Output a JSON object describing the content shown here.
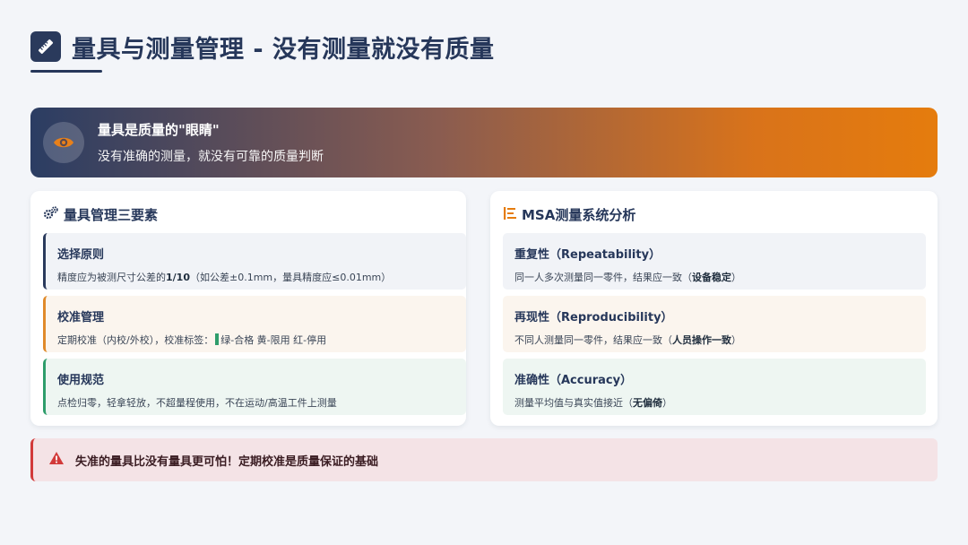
{
  "header": {
    "title": "量具与测量管理 - 没有测量就没有质量",
    "icon": "ruler-icon"
  },
  "banner": {
    "icon": "eye-icon",
    "title": "量具是质量的\"眼睛\"",
    "subtitle": "没有准确的测量，就没有可靠的质量判断"
  },
  "left_panel": {
    "icon": "gears-icon",
    "title": "量具管理三要素",
    "cards": [
      {
        "title": "选择原则",
        "body_pre": "精度应为被测尺寸公差的",
        "body_bold": "1/10",
        "body_post": "（如公差±0.1mm，量具精度应≤0.01mm）"
      },
      {
        "title": "校准管理",
        "body_pre": "定期校准（内校/外校），校准标签：",
        "body_post": "绿-合格 黄-限用 红-停用"
      },
      {
        "title": "使用规范",
        "body_pre": "点检归零，轻拿轻放，不超量程使用，不在运动/高温工件上测量"
      }
    ]
  },
  "right_panel": {
    "icon": "list-icon",
    "title": "MSA测量系统分析",
    "cards": [
      {
        "title": "重复性（Repeatability）",
        "body_pre": "同一人多次测量同一零件，结果应一致（",
        "body_bold": "设备稳定",
        "body_post": "）"
      },
      {
        "title": "再现性（Reproducibility）",
        "body_pre": "不同人测量同一零件，结果应一致（",
        "body_bold": "人员操作一致",
        "body_post": "）"
      },
      {
        "title": "准确性（Accuracy）",
        "body_pre": "测量平均值与真实值接近（",
        "body_bold": "无偏倚",
        "body_post": "）"
      }
    ]
  },
  "alert": {
    "icon": "warning-icon",
    "text": "失准的量具比没有量具更可怕！定期校准是质量保证的基础"
  },
  "colors": {
    "navy": "#26375a",
    "orange": "#e57c0d",
    "green": "#2e9d6b",
    "red": "#d23a3a"
  }
}
